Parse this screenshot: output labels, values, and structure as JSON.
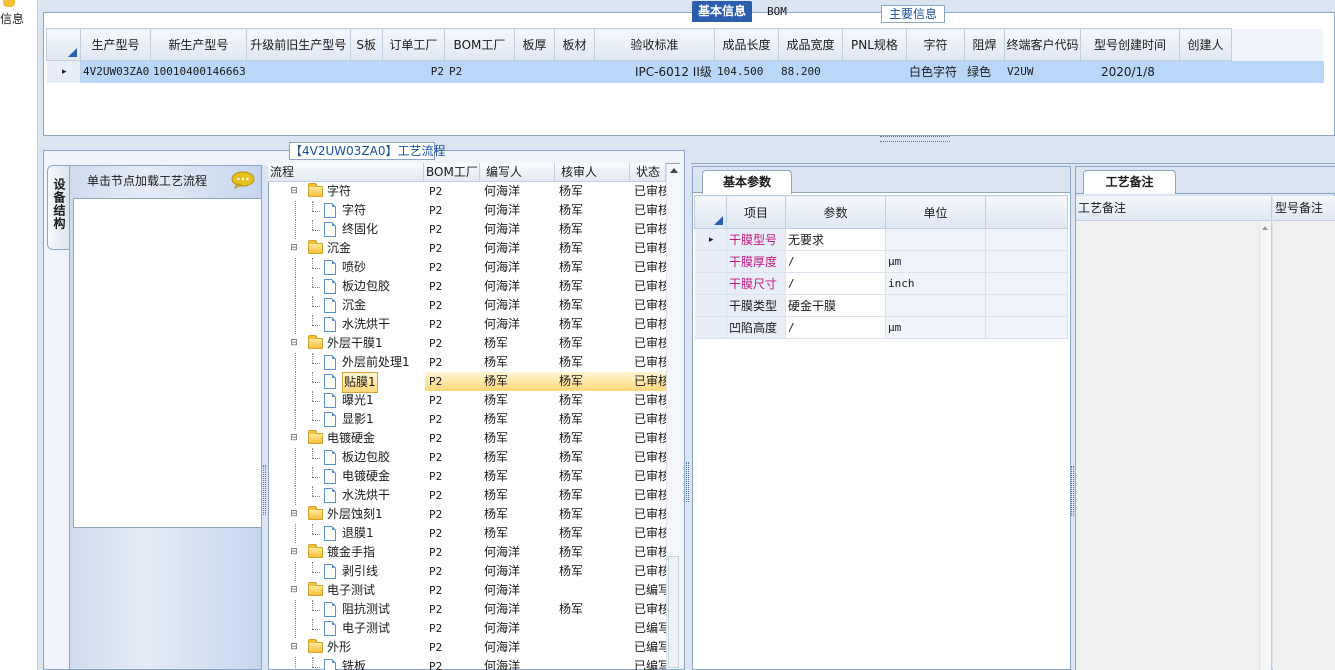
{
  "left_strip": {
    "label": "信息"
  },
  "main_info": {
    "title": "主要信息",
    "columns": [
      "生产型号",
      "新生产型号",
      "升级前旧生产型号",
      "S板",
      "订单工厂",
      "BOM工厂",
      "板厚",
      "板材",
      "验收标准",
      "成品长度",
      "成品宽度",
      "PNL规格",
      "字符",
      "阻焊",
      "终端客户代码",
      "型号创建时间",
      "创建人"
    ],
    "row": {
      "indicator": "▸",
      "values": [
        "4V2UW03ZA0",
        "10010400146663",
        "",
        "",
        "P2",
        "P2",
        "",
        "",
        "IPC-6012 II级",
        "104.500",
        "88.200",
        "",
        "白色字符",
        "绿色",
        "V2UW",
        "2020/1/8",
        ""
      ]
    }
  },
  "process": {
    "title": "【4V2UW03ZA0】工艺流程",
    "equipment_tab": "设备结构",
    "equipment_hint": "单击节点加载工艺流程",
    "columns": [
      "流程",
      "BOM工厂",
      "编写人",
      "核审人",
      "状态"
    ],
    "rows": [
      {
        "name": "字符",
        "level": 0,
        "factory": "P2",
        "writer": "何海洋",
        "reviewer": "杨军",
        "status": "已审核"
      },
      {
        "name": "字符",
        "level": 1,
        "factory": "P2",
        "writer": "何海洋",
        "reviewer": "杨军",
        "status": "已审核"
      },
      {
        "name": "终固化",
        "level": 1,
        "factory": "P2",
        "writer": "何海洋",
        "reviewer": "杨军",
        "status": "已审核"
      },
      {
        "name": "沉金",
        "level": 0,
        "factory": "P2",
        "writer": "何海洋",
        "reviewer": "杨军",
        "status": "已审核"
      },
      {
        "name": "喷砂",
        "level": 1,
        "factory": "P2",
        "writer": "何海洋",
        "reviewer": "杨军",
        "status": "已审核"
      },
      {
        "name": "板边包胶",
        "level": 1,
        "factory": "P2",
        "writer": "何海洋",
        "reviewer": "杨军",
        "status": "已审核"
      },
      {
        "name": "沉金",
        "level": 1,
        "factory": "P2",
        "writer": "何海洋",
        "reviewer": "杨军",
        "status": "已审核"
      },
      {
        "name": "水洗烘干",
        "level": 1,
        "factory": "P2",
        "writer": "何海洋",
        "reviewer": "杨军",
        "status": "已审核"
      },
      {
        "name": "外层干膜1",
        "level": 0,
        "factory": "P2",
        "writer": "杨军",
        "reviewer": "杨军",
        "status": "已审核"
      },
      {
        "name": "外层前处理1",
        "level": 1,
        "factory": "P2",
        "writer": "杨军",
        "reviewer": "杨军",
        "status": "已审核"
      },
      {
        "name": "贴膜1",
        "level": 1,
        "factory": "P2",
        "writer": "杨军",
        "reviewer": "杨军",
        "status": "已审核",
        "selected": true
      },
      {
        "name": "曝光1",
        "level": 1,
        "factory": "P2",
        "writer": "杨军",
        "reviewer": "杨军",
        "status": "已审核"
      },
      {
        "name": "显影1",
        "level": 1,
        "factory": "P2",
        "writer": "杨军",
        "reviewer": "杨军",
        "status": "已审核"
      },
      {
        "name": "电镀硬金",
        "level": 0,
        "factory": "P2",
        "writer": "杨军",
        "reviewer": "杨军",
        "status": "已审核"
      },
      {
        "name": "板边包胶",
        "level": 1,
        "factory": "P2",
        "writer": "杨军",
        "reviewer": "杨军",
        "status": "已审核"
      },
      {
        "name": "电镀硬金",
        "level": 1,
        "factory": "P2",
        "writer": "杨军",
        "reviewer": "杨军",
        "status": "已审核"
      },
      {
        "name": "水洗烘干",
        "level": 1,
        "factory": "P2",
        "writer": "杨军",
        "reviewer": "杨军",
        "status": "已审核"
      },
      {
        "name": "外层蚀刻1",
        "level": 0,
        "factory": "P2",
        "writer": "杨军",
        "reviewer": "杨军",
        "status": "已审核"
      },
      {
        "name": "退膜1",
        "level": 1,
        "factory": "P2",
        "writer": "杨军",
        "reviewer": "杨军",
        "status": "已审核"
      },
      {
        "name": "镀金手指",
        "level": 0,
        "factory": "P2",
        "writer": "何海洋",
        "reviewer": "杨军",
        "status": "已审核"
      },
      {
        "name": "剥引线",
        "level": 1,
        "factory": "P2",
        "writer": "何海洋",
        "reviewer": "杨军",
        "status": "已审核"
      },
      {
        "name": "电子测试",
        "level": 0,
        "factory": "P2",
        "writer": "何海洋",
        "reviewer": "",
        "status": "已编写"
      },
      {
        "name": "阻抗测试",
        "level": 1,
        "factory": "P2",
        "writer": "何海洋",
        "reviewer": "杨军",
        "status": "已审核"
      },
      {
        "name": "电子测试",
        "level": 1,
        "factory": "P2",
        "writer": "何海洋",
        "reviewer": "",
        "status": "已编写"
      },
      {
        "name": "外形",
        "level": 0,
        "factory": "P2",
        "writer": "何海洋",
        "reviewer": "",
        "status": "已编写"
      },
      {
        "name": "铣板",
        "level": 1,
        "factory": "P2",
        "writer": "何海洋",
        "reviewer": "",
        "status": "已编写"
      }
    ]
  },
  "detail_tabs": {
    "basic": "基本信息",
    "bom": "BOM"
  },
  "basic_params": {
    "tab": "基本参数",
    "columns": [
      "项目",
      "参数",
      "单位"
    ],
    "rows": [
      {
        "item": "干膜型号",
        "value": "无要求",
        "unit": "",
        "highlight": true,
        "indicator": "▸"
      },
      {
        "item": "干膜厚度",
        "value": "/",
        "unit": "μm",
        "highlight": true,
        "indicator": ""
      },
      {
        "item": "干膜尺寸",
        "value": "/",
        "unit": "inch",
        "highlight": true,
        "indicator": ""
      },
      {
        "item": "干膜类型",
        "value": "硬金干膜",
        "unit": "",
        "highlight": false,
        "indicator": ""
      },
      {
        "item": "凹陷高度",
        "value": "/",
        "unit": "μm",
        "highlight": false,
        "indicator": ""
      }
    ]
  },
  "process_notes": {
    "tab": "工艺备注",
    "col_process_note": "工艺备注",
    "col_model_note": "型号备注"
  },
  "colors": {
    "accent": "#2b5fad",
    "selected_row": "#b9d8f9",
    "highlight_item": "#c0197d",
    "panel_bg": "#dbe5f2"
  }
}
